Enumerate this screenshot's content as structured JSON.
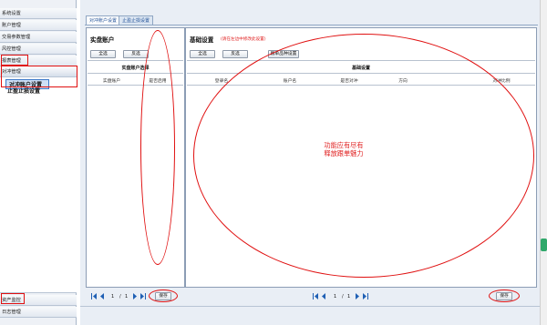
{
  "sidebar": {
    "items": [
      {
        "label": "系统设置"
      },
      {
        "label": "账户管理"
      },
      {
        "label": "交易参数管理"
      },
      {
        "label": "风控管理"
      },
      {
        "label": "报表管理"
      },
      {
        "label": "对冲管理"
      }
    ],
    "sub_items": [
      {
        "label": "对冲账户设置"
      },
      {
        "label": "止盈止损设置"
      }
    ],
    "bottom_items": [
      {
        "label": "资产监控"
      },
      {
        "label": "日志管理"
      }
    ]
  },
  "tabs": [
    {
      "label": "对冲账户设置"
    },
    {
      "label": "止盈止损设置"
    }
  ],
  "left_panel": {
    "title": "实盘账户",
    "select_all": "全选",
    "invert": "反选",
    "grid_title": "实盘账户选择",
    "columns": [
      "实盘账户",
      "是否启用"
    ]
  },
  "right_panel": {
    "title": "基础设置",
    "note": "(请在左边中修改此设置)",
    "select_all": "全选",
    "invert": "反选",
    "product_settings": "跟单品种设置",
    "grid_title": "基础设置",
    "columns": [
      "登录名",
      "账户名",
      "是否对冲",
      "方向",
      "对冲比例"
    ],
    "annotation_line1": "功能应有尽有",
    "annotation_line2": "释放跟单魅力"
  },
  "pagination_left": {
    "page": "1",
    "sep": "/",
    "total": "1"
  },
  "pagination_right": {
    "page": "1",
    "sep": "/",
    "total": "1"
  },
  "save_left": "保存",
  "save_right": "保存",
  "colors": {
    "annotation": "#e01010",
    "link": "#1e5fb4",
    "panel_border": "#8c9db5"
  }
}
